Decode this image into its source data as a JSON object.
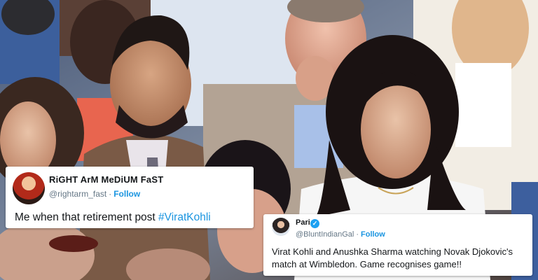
{
  "tweets": [
    {
      "name": "RiGHT ArM MeDiUM FaST",
      "handle": "@rightarm_fast",
      "separator": "·",
      "follow_label": "Follow",
      "text_prefix": "Me when that retirement post ",
      "hashtag": "#ViratKohli",
      "avatar_icon": "profile-avatar"
    },
    {
      "name": "Pari",
      "handle": "@BluntIndianGal",
      "separator": "·",
      "follow_label": "Follow",
      "verified": "✓",
      "text": "Virat Kohli and Anushka Sharma watching Novak Djokovic's match at Wimbledon. Game recognises game!!",
      "avatar_icon": "profile-avatar"
    }
  ],
  "colors": {
    "link": "#1b95e0",
    "verified": "#1da1f2",
    "text": "#14171a",
    "muted": "#657786"
  }
}
